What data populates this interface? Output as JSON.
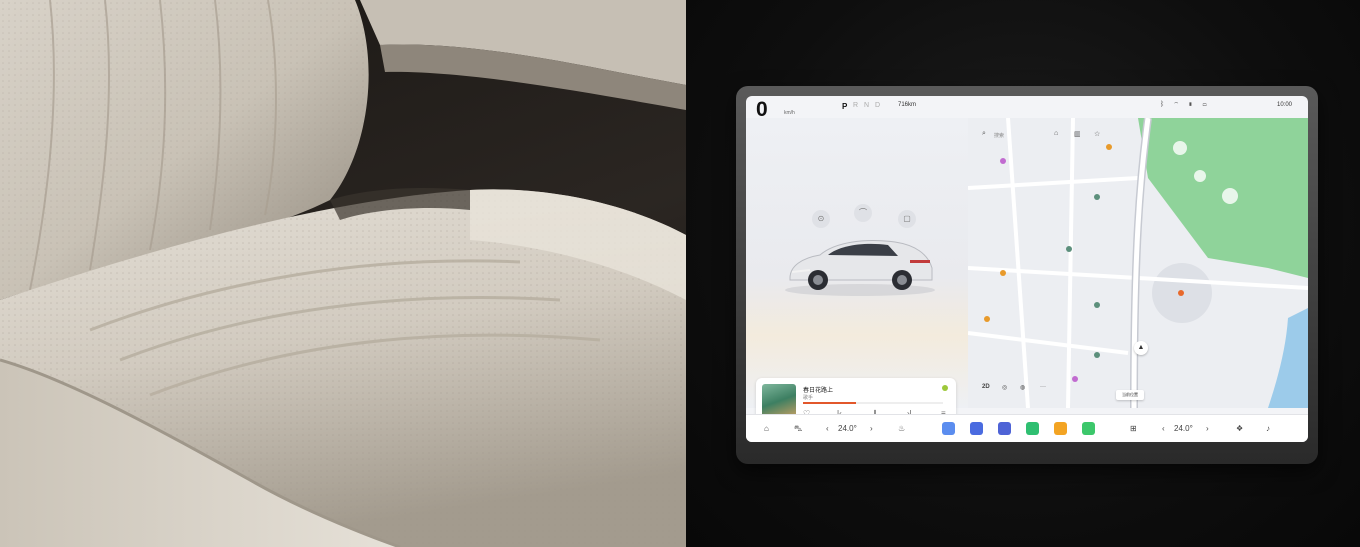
{
  "display": {
    "status_bar": {
      "speed": "0",
      "speed_unit": "km/h",
      "gear_active": "P",
      "gear_others": "R N D",
      "range": "716km",
      "clock": "10:00",
      "status_icons": [
        "bluetooth-icon",
        "wifi-icon",
        "signal-icon",
        "battery-icon"
      ]
    },
    "vehicle": {
      "quick_controls": [
        "lock-icon",
        "wiper-icon",
        "trunk-icon"
      ],
      "car_color": "#e8e8ea"
    },
    "music": {
      "title": "春日花路上",
      "artist": "歌手",
      "progress": 0.38,
      "controls": [
        "heart-icon",
        "previous-icon",
        "pause-icon",
        "next-icon",
        "list-icon"
      ]
    },
    "map": {
      "search_placeholder": "搜索",
      "shortcut_icons": [
        "home-icon",
        "company-icon",
        "favorite-icon"
      ],
      "view_mode": "2D",
      "current_location": "当前位置",
      "pois": [
        {
          "label": "",
          "color": "#c16bd0"
        },
        {
          "label": "",
          "color": "#e89a2b"
        },
        {
          "label": "",
          "color": "#5c8f7c"
        },
        {
          "label": "",
          "color": "#5c8f7c"
        },
        {
          "label": "",
          "color": "#e89a2b"
        },
        {
          "label": "",
          "color": "#e89a2b"
        },
        {
          "label": "",
          "color": "#5c8f7c"
        },
        {
          "label": "",
          "color": "#e8692b"
        },
        {
          "label": "",
          "color": "#5c8f7c"
        },
        {
          "label": "",
          "color": "#c16bd0"
        }
      ],
      "park_color": "#8fd39a",
      "water_color": "#9ccbea"
    },
    "dock": {
      "driver_temp": "24.0°",
      "passenger_temp": "24.0°",
      "apps": [
        {
          "name": "car-app-icon",
          "color": "#5b8def"
        },
        {
          "name": "files-app-icon",
          "color": "#4a6be0"
        },
        {
          "name": "calendar-app-icon",
          "color": "#4e63d6"
        },
        {
          "name": "phone-app-icon",
          "color": "#2fbf71"
        },
        {
          "name": "music-app-icon",
          "color": "#f3a423"
        },
        {
          "name": "message-app-icon",
          "color": "#3cc76b"
        }
      ]
    }
  }
}
